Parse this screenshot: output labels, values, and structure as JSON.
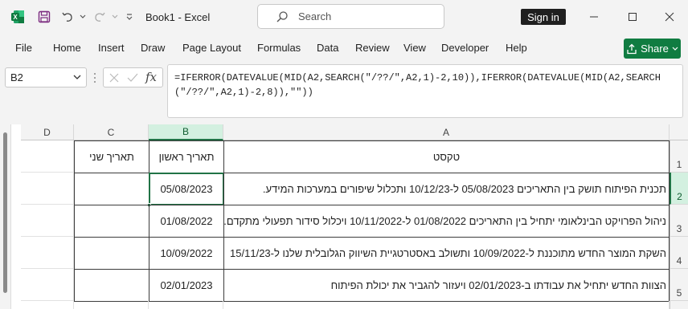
{
  "titlebar": {
    "doc_title": "Book1  -  Excel",
    "search_placeholder": "Search",
    "signin_label": "Sign in",
    "icons": [
      "excel-logo",
      "save",
      "undo",
      "redo",
      "customize-quick-access",
      "search",
      "minimize",
      "restore",
      "close"
    ]
  },
  "menu": {
    "items": [
      "File",
      "Home",
      "Insert",
      "Draw",
      "Page Layout",
      "Formulas",
      "Data",
      "Review",
      "View",
      "Developer",
      "Help"
    ],
    "share_label": "Share"
  },
  "formula_bar": {
    "name_box": "B2",
    "formula": "=IFERROR(DATEVALUE(MID(A2,SEARCH(\"/??/\",A2,1)-2,10)),IFERROR(DATEVALUE(MID(A2,SEARCH(\"/??/\",A2,1)-2,8)),\"\"))"
  },
  "sheet": {
    "columns": [
      "D",
      "C",
      "B",
      "A"
    ],
    "rows": [
      "1",
      "2",
      "3",
      "4",
      "5"
    ],
    "headers": {
      "A": "טקסט",
      "B": "תאריך ראשון",
      "C": "תאריך שני"
    },
    "data": [
      {
        "A": "תכנית הפיתוח תושק בין התאריכים 05/08/2023 ל-10/12/23 ותכלול שיפורים במערכות המידע.",
        "B": "05/08/2023",
        "C": ""
      },
      {
        "A": "ניהול הפרויקט הבינלאומי יתחיל בין התאריכים 01/08/2022 ל-10/11/2022 ויכלול סידור תפעולי מתקדם.",
        "B": "01/08/2022",
        "C": ""
      },
      {
        "A": "השקת המוצר החדש מתוכננת ל-10/09/2022 ותשולב באסטרטגיית השיווק הגלובלית שלנו ל-15/11/23",
        "B": "10/09/2022",
        "C": ""
      },
      {
        "A": "הצוות החדש יתחיל את עבודתו ב-02/01/2023 ויעזור להגביר את יכולת הפיתוח",
        "B": "02/01/2023",
        "C": ""
      }
    ],
    "selected_cell": "B2"
  },
  "colors": {
    "excel_green": "#107c41",
    "selection_green": "#217346"
  }
}
